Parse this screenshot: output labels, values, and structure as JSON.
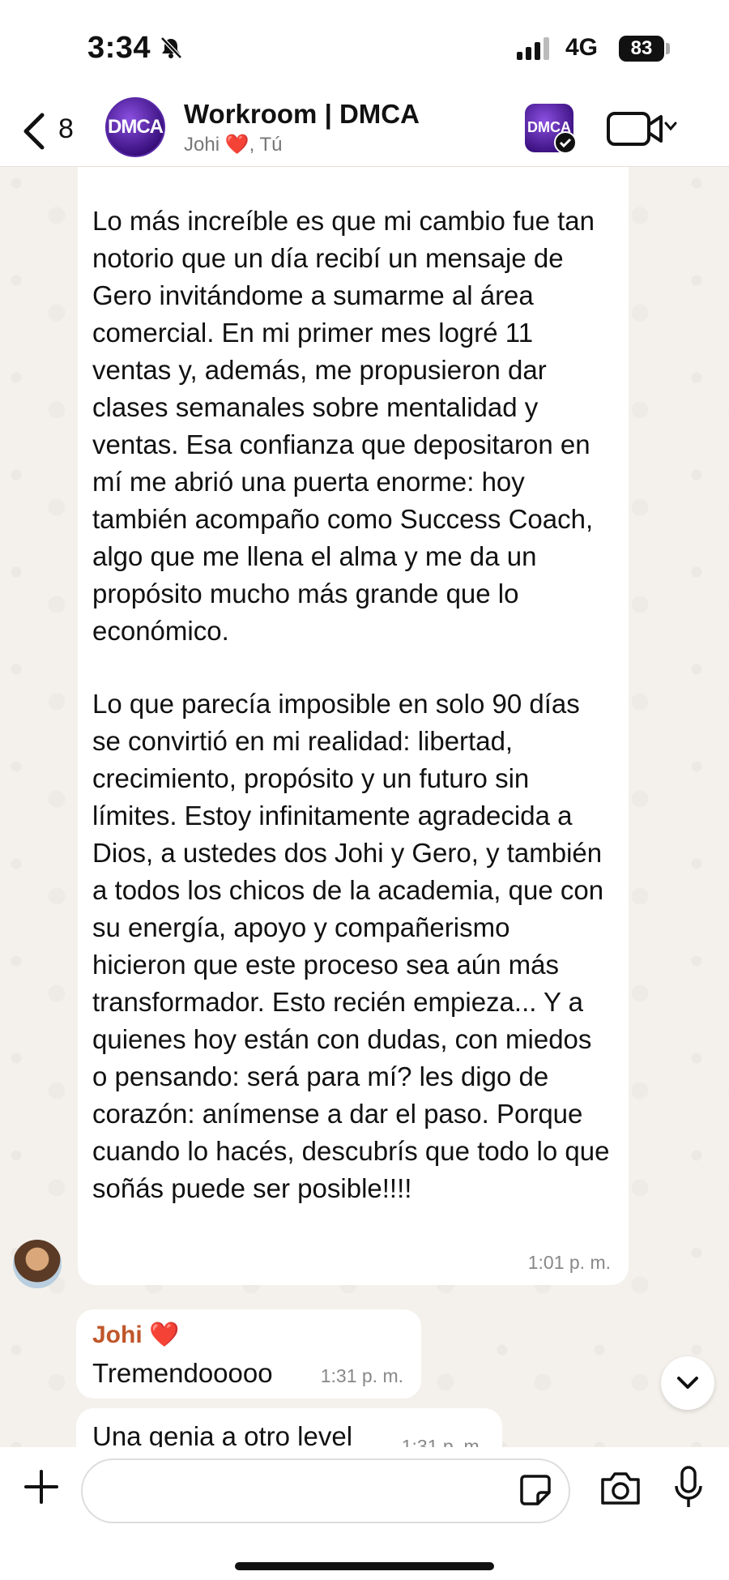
{
  "status_bar": {
    "time": "3:34",
    "network": "4G",
    "battery": "83",
    "icons": [
      "bell-muted-icon",
      "signal-icon"
    ]
  },
  "header": {
    "back_count": "8",
    "group_avatar_text": "DMCA",
    "title": "Workroom | DMCA",
    "subtitle_prefix": "Johi",
    "subtitle_heart": "❤️",
    "subtitle_suffix": ", Tú",
    "small_avatar_text": "DMCA",
    "icons": [
      "back-icon",
      "verified-icon",
      "video-call-icon",
      "chevron-down-icon"
    ]
  },
  "messages": [
    {
      "paragraphs": [
        "Lo más increíble es que mi cambio fue tan notorio que un día recibí un mensaje de Gero invitándome a sumarme al área comercial. En mi primer mes logré 11 ventas y, además, me propusieron dar clases semanales sobre mentalidad y ventas. Esa confianza que depositaron en mí me abrió una puerta enorme: hoy también acompaño como Success Coach, algo que me llena el alma y me da un propósito mucho más grande que lo económico.",
        "Lo que parecía imposible en solo 90 días se convirtió en mi realidad: libertad, crecimiento, propósito y un futuro sin límites. Estoy infinitamente agradecida a Dios, a ustedes dos Johi y Gero, y también a todos los chicos de la academia, que con su energía, apoyo y compañerismo hicieron que este proceso sea aún más transformador. Esto recién empieza... Y a quienes hoy están con dudas, con miedos o pensando: será para mí? les digo de corazón: anímense a dar el paso. Porque cuando lo hacés, descubrís que todo lo que soñás puede ser posible!!!!"
      ],
      "time": "1:01 p. m."
    },
    {
      "sender": "Johi",
      "sender_heart": "❤️",
      "text": "Tremendooooo",
      "time": "1:31 p. m."
    },
    {
      "text": "Una genia a otro level",
      "time": "1:31 p. m."
    }
  ],
  "input": {
    "placeholder": "",
    "icons": [
      "plus-icon",
      "sticker-icon",
      "camera-icon",
      "microphone-icon"
    ]
  },
  "colors": {
    "chat_background": "#f4f1ec",
    "bubble": "#ffffff",
    "sender_name": "#c0562a",
    "heart": "#d11a1a",
    "avatar_purple": "#3b1180"
  }
}
